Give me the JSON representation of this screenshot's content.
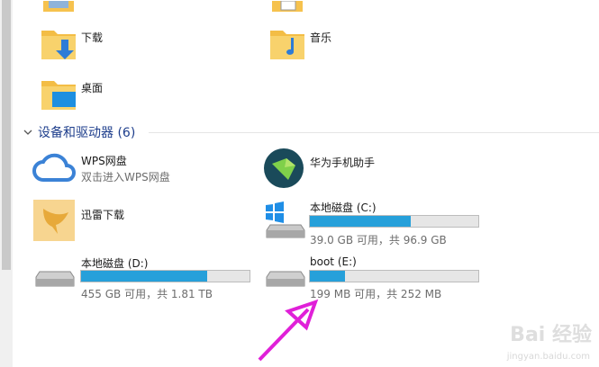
{
  "folders": [
    {
      "label": "下载"
    },
    {
      "label": "音乐"
    },
    {
      "label": "桌面"
    }
  ],
  "section": {
    "title": "设备和驱动器 (6)"
  },
  "devices": {
    "wps": {
      "name": "WPS网盘",
      "sub": "双击进入WPS网盘"
    },
    "huawei": {
      "name": "华为手机助手"
    },
    "xunlei": {
      "name": "迅雷下载"
    },
    "drive_c": {
      "name": "本地磁盘 (C:)",
      "info": "39.0 GB 可用，共 96.9 GB",
      "used_fraction": 0.6
    },
    "drive_d": {
      "name": "本地磁盘 (D:)",
      "info": "455 GB 可用，共 1.81 TB",
      "used_fraction": 0.75
    },
    "drive_e": {
      "name": "boot (E:)",
      "info": "199 MB 可用，共 252 MB",
      "used_fraction": 0.21
    }
  },
  "watermark": {
    "brand": "Bai 经验",
    "url": "jingyan.baidu.com"
  },
  "colors": {
    "accent": "#26a0da",
    "arrow": "#e020d8",
    "section": "#1e3e8c"
  }
}
